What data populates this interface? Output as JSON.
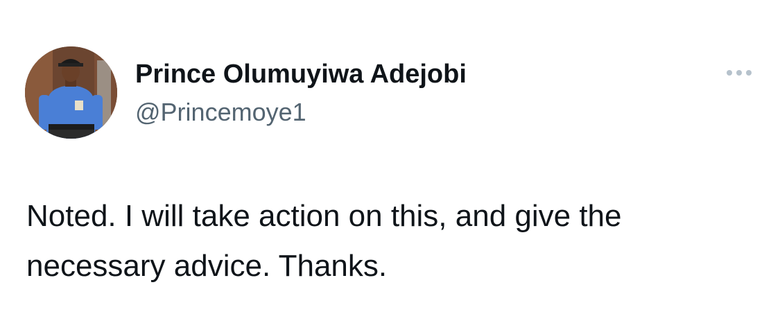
{
  "author": {
    "display_name": "Prince Olumuyiwa Adejobi",
    "handle": "@Princemoye1",
    "avatar_icon": "profile-photo-police-officer"
  },
  "menu": {
    "icon": "more-horizontal-icon"
  },
  "tweet": {
    "text": "Noted. I will take action on this, and give the necessary advice. Thanks."
  },
  "colors": {
    "text_primary": "#0f1419",
    "text_secondary": "#536471",
    "more_dots": "#b6c2cc",
    "background": "#ffffff"
  }
}
